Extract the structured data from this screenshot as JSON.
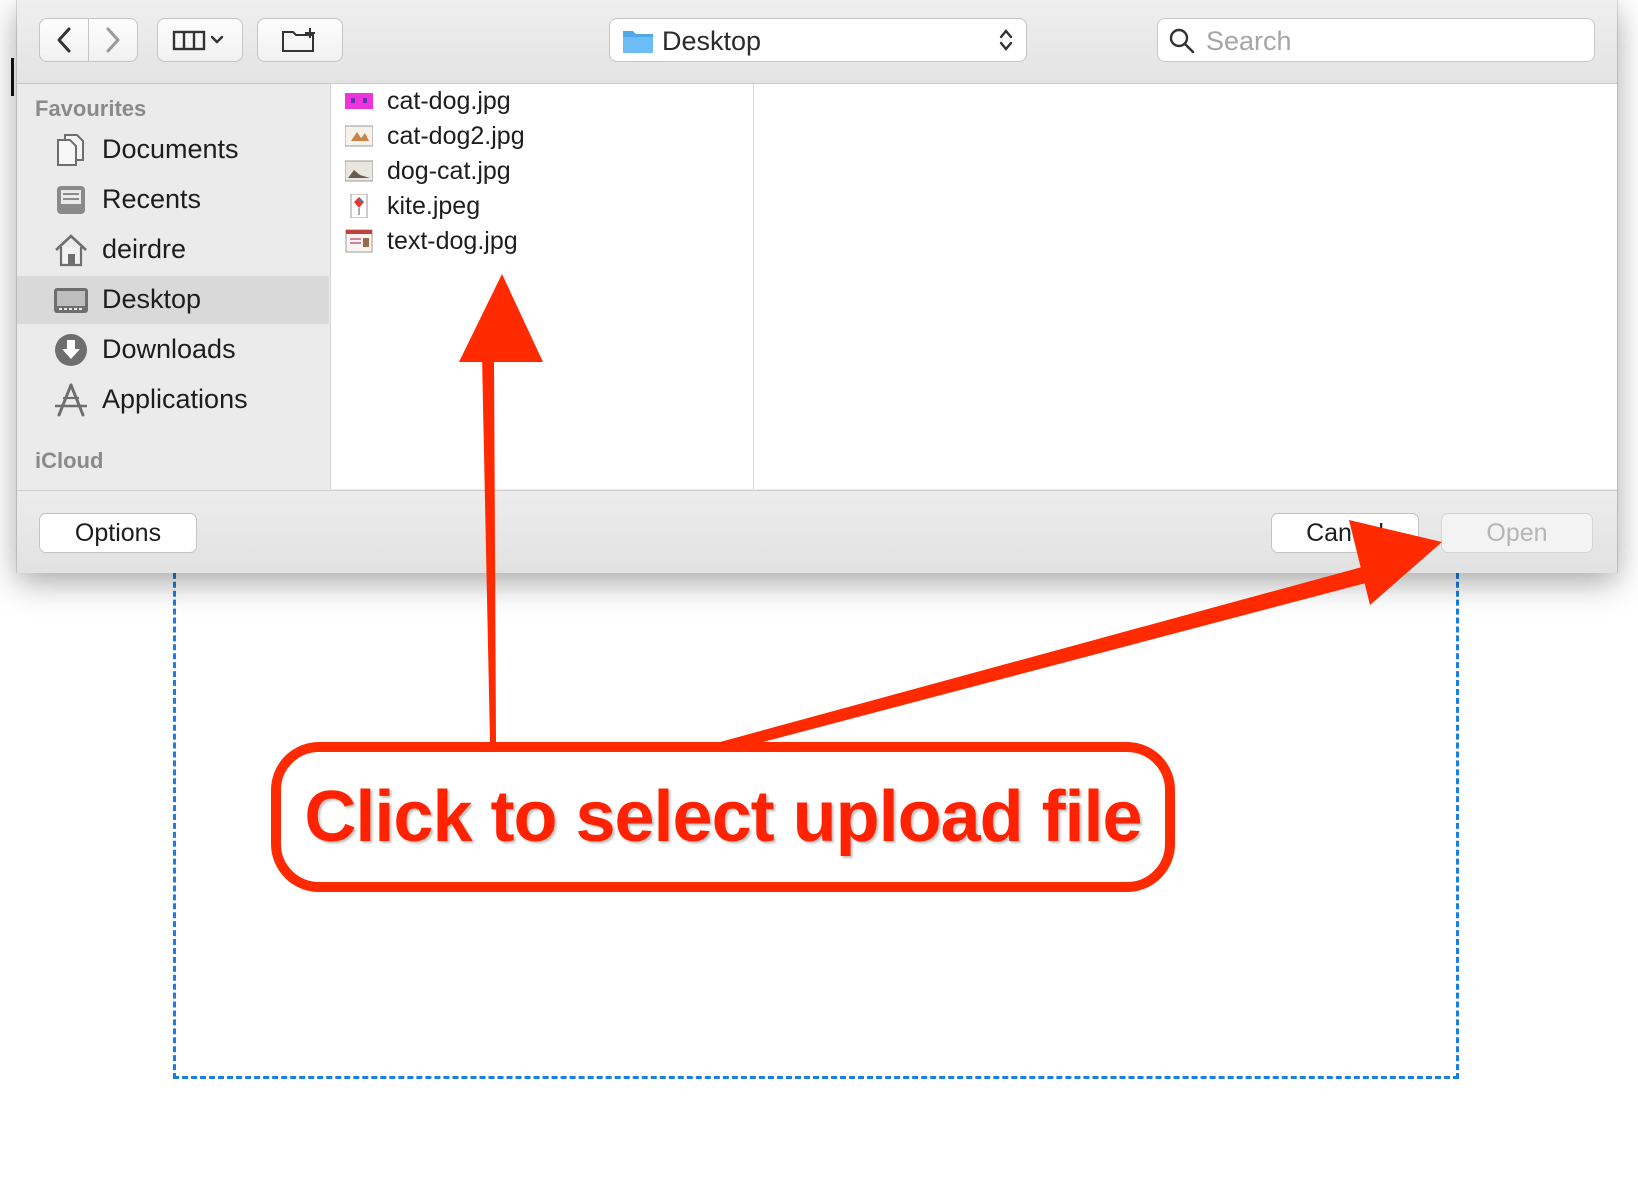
{
  "dialog": {
    "toolbar": {
      "back_icon": "chevron-left-icon",
      "forward_icon": "chevron-right-icon",
      "view_icon": "column-view-icon",
      "new_folder_icon": "new-folder-icon",
      "location": "Desktop",
      "search_placeholder": "Search"
    },
    "sidebar": {
      "favourites_title": "Favourites",
      "items": [
        {
          "label": "Documents",
          "icon": "documents-icon"
        },
        {
          "label": "Recents",
          "icon": "recents-icon"
        },
        {
          "label": "deirdre",
          "icon": "home-icon"
        },
        {
          "label": "Desktop",
          "icon": "desktop-icon",
          "selected": true
        },
        {
          "label": "Downloads",
          "icon": "downloads-icon"
        },
        {
          "label": "Applications",
          "icon": "applications-icon"
        }
      ],
      "icloud_title": "iCloud"
    },
    "files": [
      {
        "name": "cat-dog.jpg"
      },
      {
        "name": "cat-dog2.jpg"
      },
      {
        "name": "dog-cat.jpg"
      },
      {
        "name": "kite.jpeg"
      },
      {
        "name": "text-dog.jpg"
      }
    ],
    "buttons": {
      "options": "Options",
      "cancel": "Cancel",
      "open": "Open"
    }
  },
  "annotation": {
    "text": "Click to select upload file",
    "color": "#ff2200"
  },
  "colors": {
    "drop_zone_border": "#1a7fe0",
    "folder_blue": "#4fa8ea"
  }
}
